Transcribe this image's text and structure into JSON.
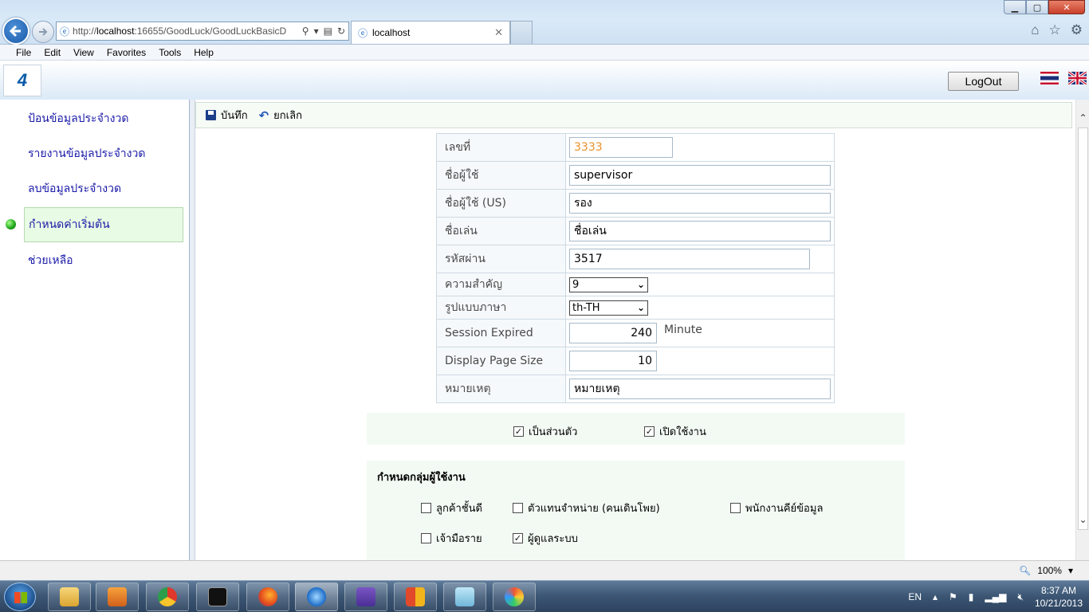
{
  "browser": {
    "url_prefix": "http://",
    "url_host": "localhost",
    "url_rest": ":16655/GoodLuck/GoodLuckBasicD",
    "tab_title": "localhost",
    "menu": [
      "File",
      "Edit",
      "View",
      "Favorites",
      "Tools",
      "Help"
    ],
    "zoom": "100%"
  },
  "header": {
    "logo_text": "4",
    "logout_label": "LogOut"
  },
  "nav": {
    "items": [
      {
        "label": "ป้อนข้อมูลประจำงวด"
      },
      {
        "label": "รายงานข้อมูลประจำงวด"
      },
      {
        "label": "ลบข้อมูลประจำงวด"
      },
      {
        "label": "กำหนดค่าเริ่มต้น",
        "active": true
      },
      {
        "label": "ช่วยเหลือ"
      }
    ]
  },
  "toolbar": {
    "save_label": "บันทึก",
    "cancel_label": "ยกเลิก"
  },
  "form": {
    "id_label": "เลขที่",
    "id_value": "3333",
    "username_label": "ชื่อผู้ใช้",
    "username_value": "supervisor",
    "username_us_label": "ชื่อผู้ใช้ (US)",
    "username_us_value": "รอง",
    "nickname_label": "ชื่อเล่น",
    "nickname_value": "ชื่อเล่น",
    "password_label": "รหัสผ่าน",
    "password_value": "3517",
    "priority_label": "ความสำคัญ",
    "priority_value": "9",
    "language_label": "รูปแบบภาษา",
    "language_value": "th-TH",
    "session_label": "Session Expired",
    "session_value": "240",
    "session_unit": "Minute",
    "pagesize_label": "Display Page Size",
    "pagesize_value": "10",
    "remark_label": "หมายเหตุ",
    "remark_value": "หมายเหตุ"
  },
  "options": {
    "private_label": "เป็นส่วนตัว",
    "private_checked": true,
    "enabled_label": "เปิดใช้งาน",
    "enabled_checked": true
  },
  "groups": {
    "title": "กำหนดกลุ่มผู้ใช้งาน",
    "items": [
      {
        "label": "ลูกค้าชั้นดี",
        "checked": false
      },
      {
        "label": "ตัวแทนจำหน่าย (คนเดินโพย)",
        "checked": false
      },
      {
        "label": "พนักงานคีย์ข้อมูล",
        "checked": false
      },
      {
        "label": "เจ้ามือราย",
        "checked": false
      },
      {
        "label": "ผู้ดูแลระบบ",
        "checked": true
      }
    ]
  },
  "taskbar": {
    "lang": "EN",
    "time": "8:37 AM",
    "date": "10/21/2013"
  }
}
